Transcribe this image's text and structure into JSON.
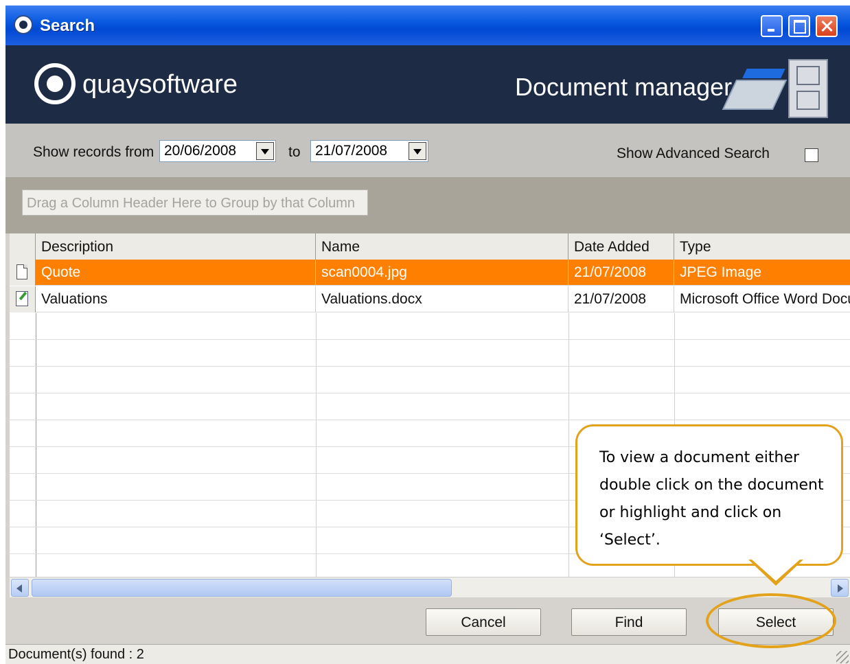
{
  "window": {
    "title": "Search"
  },
  "banner": {
    "logo_text": "quaysoftware",
    "heading": "Document manager"
  },
  "filter": {
    "from_label": "Show records from",
    "from_value": "20/06/2008",
    "to_label": "to",
    "to_value": "21/07/2008",
    "advanced_label": "Show Advanced Search",
    "advanced_checked": false
  },
  "group_hint": "Drag a Column Header Here to Group by that Column",
  "grid": {
    "columns": [
      "Description",
      "Name",
      "Date Added",
      "Type"
    ],
    "rows": [
      {
        "icon": "document-icon",
        "description": "Quote",
        "name": "scan0004.jpg",
        "date": "21/07/2008",
        "type": "JPEG Image",
        "selected": true
      },
      {
        "icon": "edit-document-icon",
        "description": "Valuations",
        "name": "Valuations.docx",
        "date": "21/07/2008",
        "type": "Microsoft Office Word Docu",
        "selected": false
      }
    ]
  },
  "buttons": {
    "cancel": "Cancel",
    "find": "Find",
    "select": "Select"
  },
  "status": "Document(s) found : 2",
  "callout": "To view a document either double click on the document or highlight and click on ‘Select’.",
  "colors": {
    "selected_row": "#ff8000",
    "banner": "#1d2b44",
    "callout_border": "#e3a21b"
  }
}
